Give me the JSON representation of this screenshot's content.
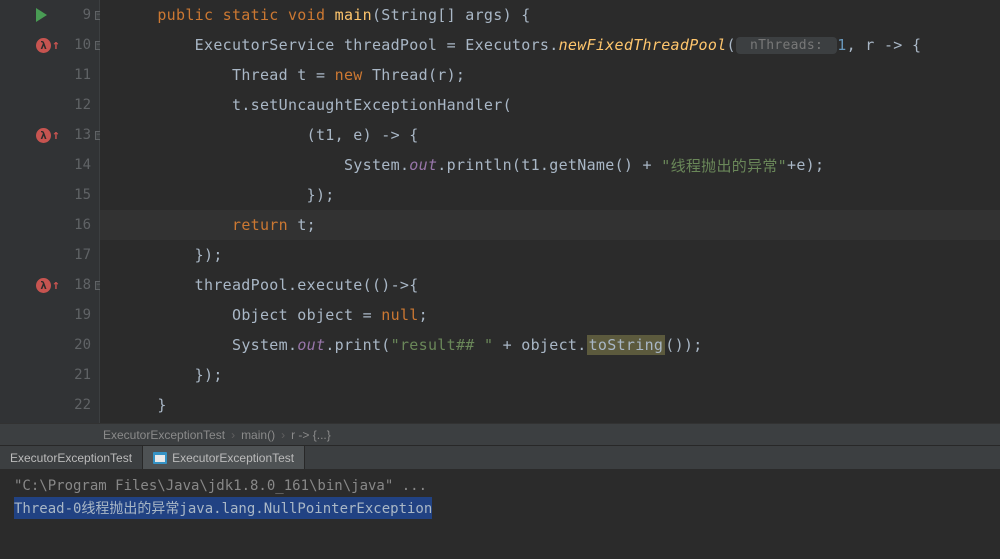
{
  "lines": [
    {
      "n": "9",
      "icon": "run",
      "fold": true
    },
    {
      "n": "10",
      "icon": "lambda",
      "fold": true
    },
    {
      "n": "11"
    },
    {
      "n": "12"
    },
    {
      "n": "13",
      "icon": "lambda",
      "fold": true
    },
    {
      "n": "14"
    },
    {
      "n": "15"
    },
    {
      "n": "16",
      "hl": true
    },
    {
      "n": "17"
    },
    {
      "n": "18",
      "icon": "lambda",
      "fold": true
    },
    {
      "n": "19"
    },
    {
      "n": "20"
    },
    {
      "n": "21"
    },
    {
      "n": "22"
    }
  ],
  "code": {
    "l9": {
      "indent": "    ",
      "k1": "public static void ",
      "fn": "main",
      "rest": "(String[] args) {"
    },
    "l10": {
      "indent": "        ",
      "t1": "ExecutorService threadPool = Executors.",
      "fn": "newFixedThreadPool",
      "open": "(",
      "hint": " nThreads: ",
      "num": "1",
      "rest": ", r -> {"
    },
    "l11": {
      "indent": "            ",
      "t1": "Thread t = ",
      "k1": "new ",
      "t2": "Thread(r);"
    },
    "l12": {
      "indent": "            ",
      "t1": "t.setUncaughtExceptionHandler("
    },
    "l13": {
      "indent": "                    ",
      "t1": "(t1, e) -> {"
    },
    "l14": {
      "indent": "                        ",
      "t1": "System.",
      "f": "out",
      "t2": ".println(t1.getName() + ",
      "s": "\"线程抛出的异常\"",
      "t3": "+e);"
    },
    "l15": {
      "indent": "                    ",
      "t1": "});"
    },
    "l16": {
      "indent": "            ",
      "k1": "return ",
      "t1": "t;"
    },
    "l17": {
      "indent": "        ",
      "t1": "});"
    },
    "l18": {
      "indent": "        ",
      "t1": "threadPool.execute(()->{"
    },
    "l19": {
      "indent": "            ",
      "t1": "Object object = ",
      "k1": "null",
      "t2": ";"
    },
    "l20": {
      "indent": "            ",
      "t1": "System.",
      "f": "out",
      "t2": ".print(",
      "s": "\"result## \"",
      "t3": " + object.",
      "ts": "toString",
      "t4": "());"
    },
    "l21": {
      "indent": "        ",
      "t1": "});"
    },
    "l22": {
      "indent": "    ",
      "t1": "}"
    }
  },
  "breadcrumb": {
    "c1": "ExecutorExceptionTest",
    "c2": "main()",
    "c3": "r -> {...}"
  },
  "tabs": {
    "t1": "ExecutorExceptionTest",
    "t2": "ExecutorExceptionTest"
  },
  "console": {
    "cmd": "\"C:\\Program Files\\Java\\jdk1.8.0_161\\bin\\java\" ...",
    "out": "Thread-0线程抛出的异常java.lang.NullPointerException"
  }
}
